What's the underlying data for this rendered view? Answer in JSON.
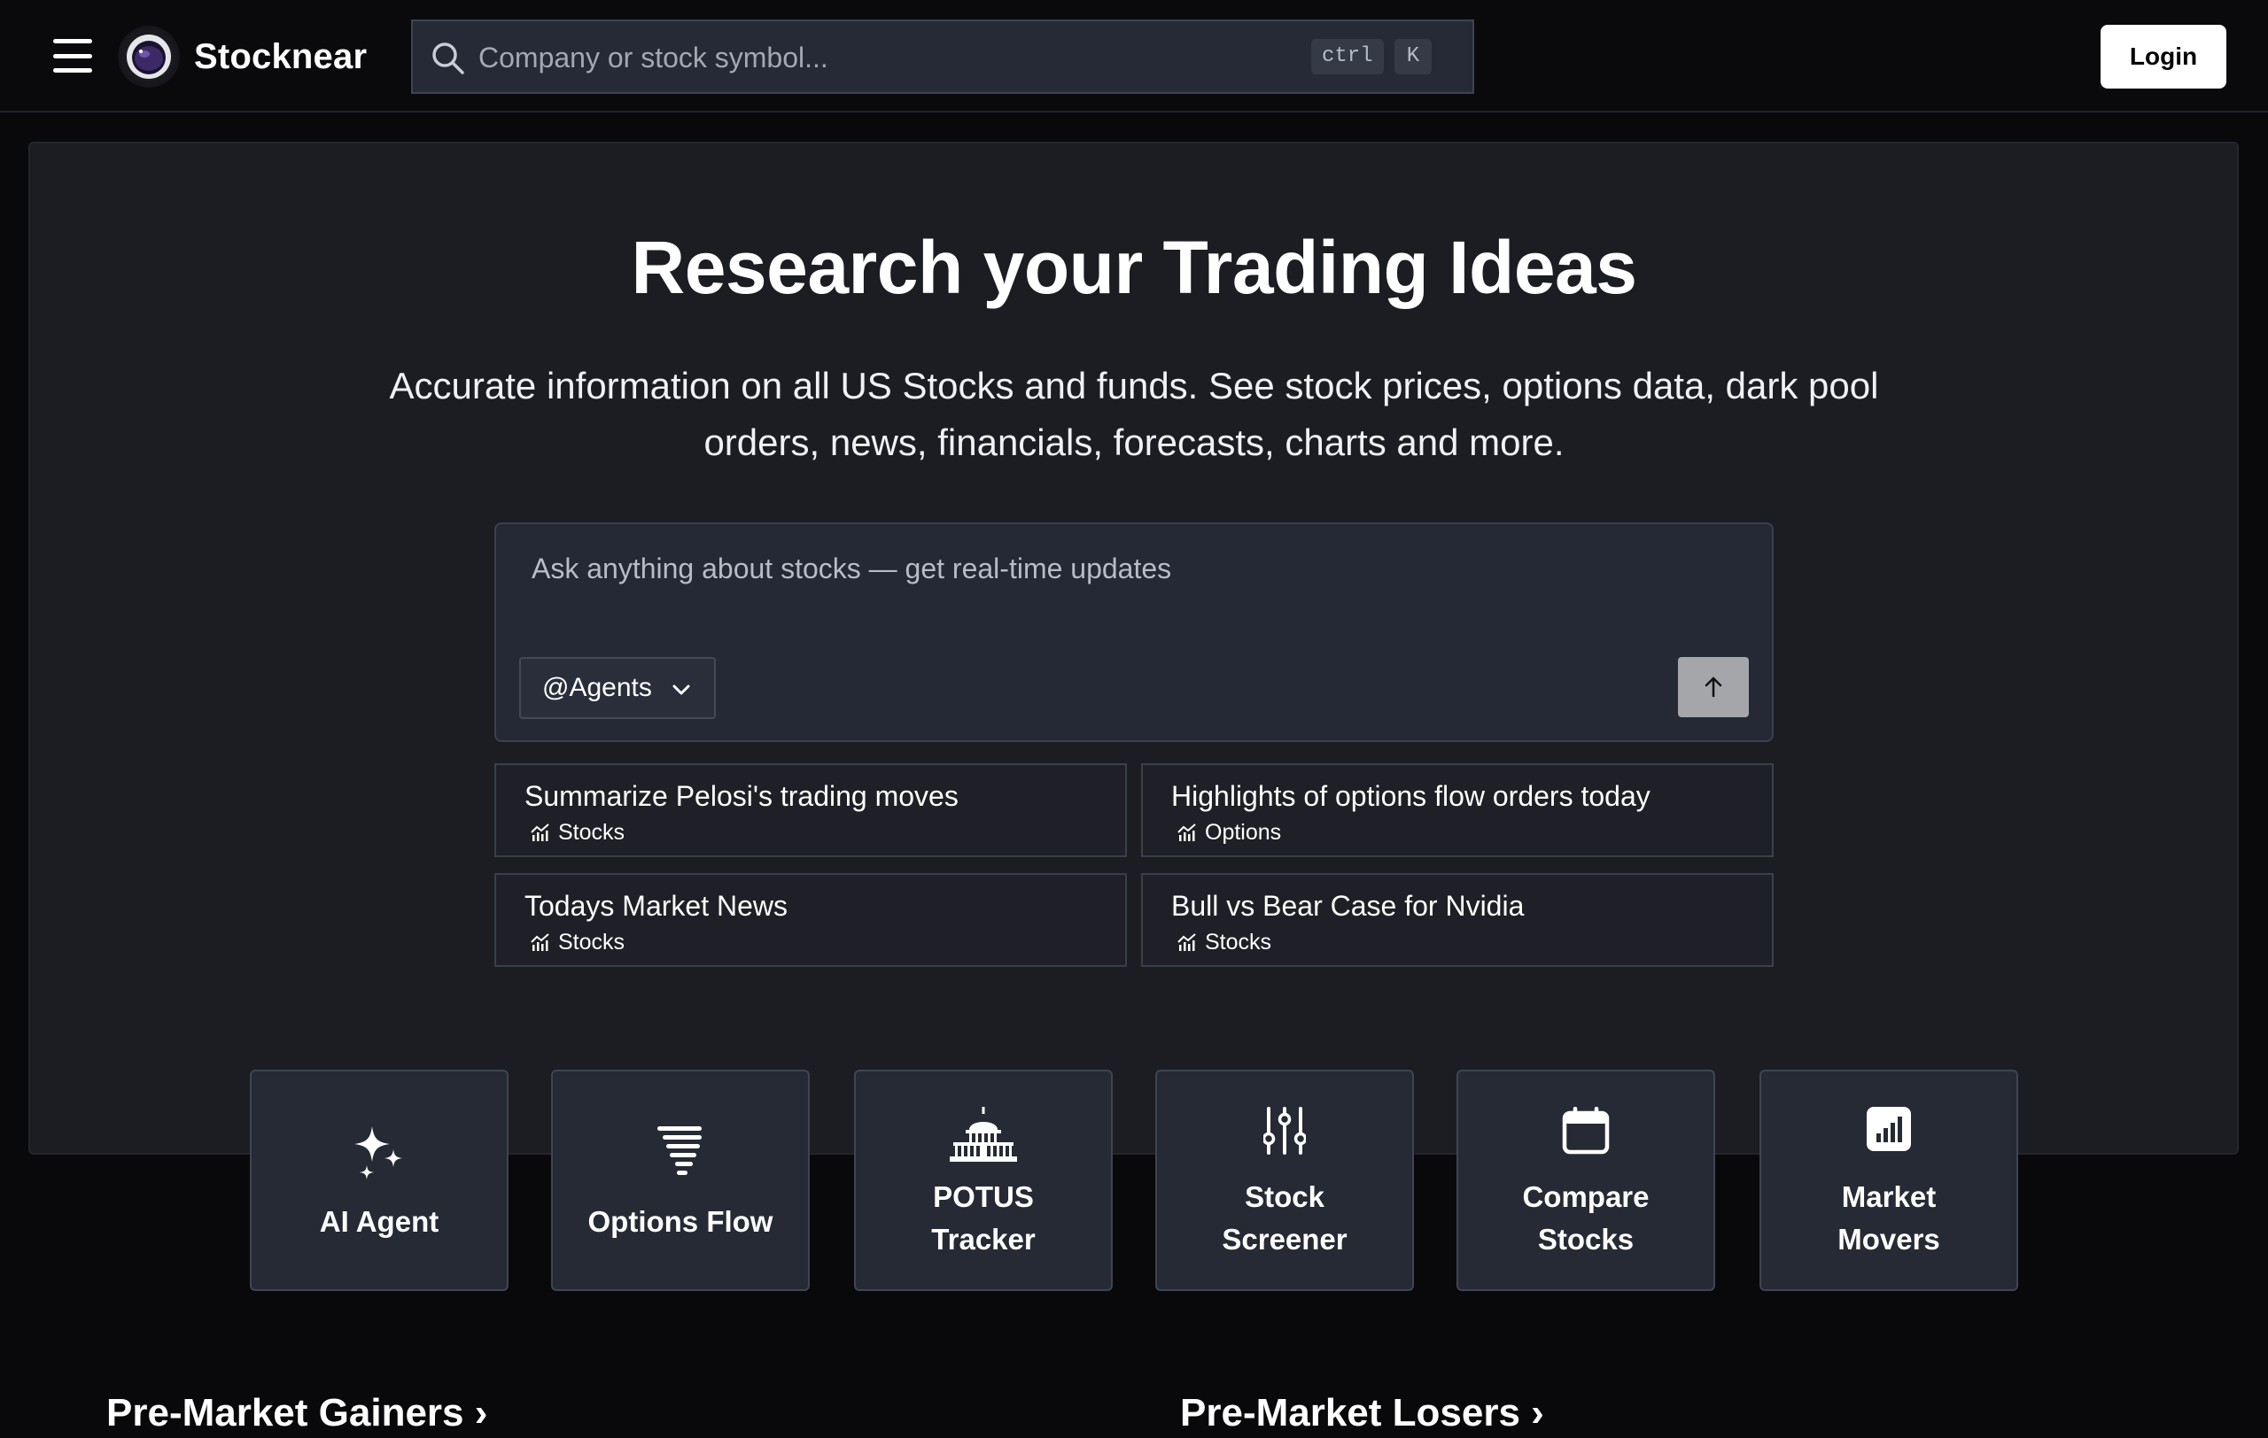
{
  "navbar": {
    "brand": "Stocknear",
    "search_placeholder": "Company or stock symbol...",
    "shortcut_ctrl": "ctrl",
    "shortcut_key": "K",
    "login_label": "Login"
  },
  "hero": {
    "title": "Research your Trading Ideas",
    "subtitle": "Accurate information on all US Stocks and funds. See stock prices, options data, dark pool orders, news, financials, forecasts, charts and more."
  },
  "ask": {
    "placeholder": "Ask anything about stocks — get real-time updates",
    "agents_label": "@Agents"
  },
  "suggestions": [
    {
      "title": "Summarize Pelosi's trading moves",
      "tag": "Stocks"
    },
    {
      "title": "Highlights of options flow orders today",
      "tag": "Options"
    },
    {
      "title": "Todays Market News",
      "tag": "Stocks"
    },
    {
      "title": "Bull vs Bear Case for Nvidia",
      "tag": "Stocks"
    }
  ],
  "tiles": [
    {
      "line1": "AI Agent",
      "line2": "",
      "icon": "sparkles-icon"
    },
    {
      "line1": "Options Flow",
      "line2": "",
      "icon": "tornado-icon"
    },
    {
      "line1": "POTUS",
      "line2": "Tracker",
      "icon": "capitol-icon"
    },
    {
      "line1": "Stock",
      "line2": "Screener",
      "icon": "sliders-icon"
    },
    {
      "line1": "Compare",
      "line2": "Stocks",
      "icon": "calendar-icon"
    },
    {
      "line1": "Market",
      "line2": "Movers",
      "icon": "bar-chart-icon"
    }
  ],
  "sections": {
    "gainers": "Pre-Market Gainers ›",
    "losers": "Pre-Market Losers ›"
  }
}
